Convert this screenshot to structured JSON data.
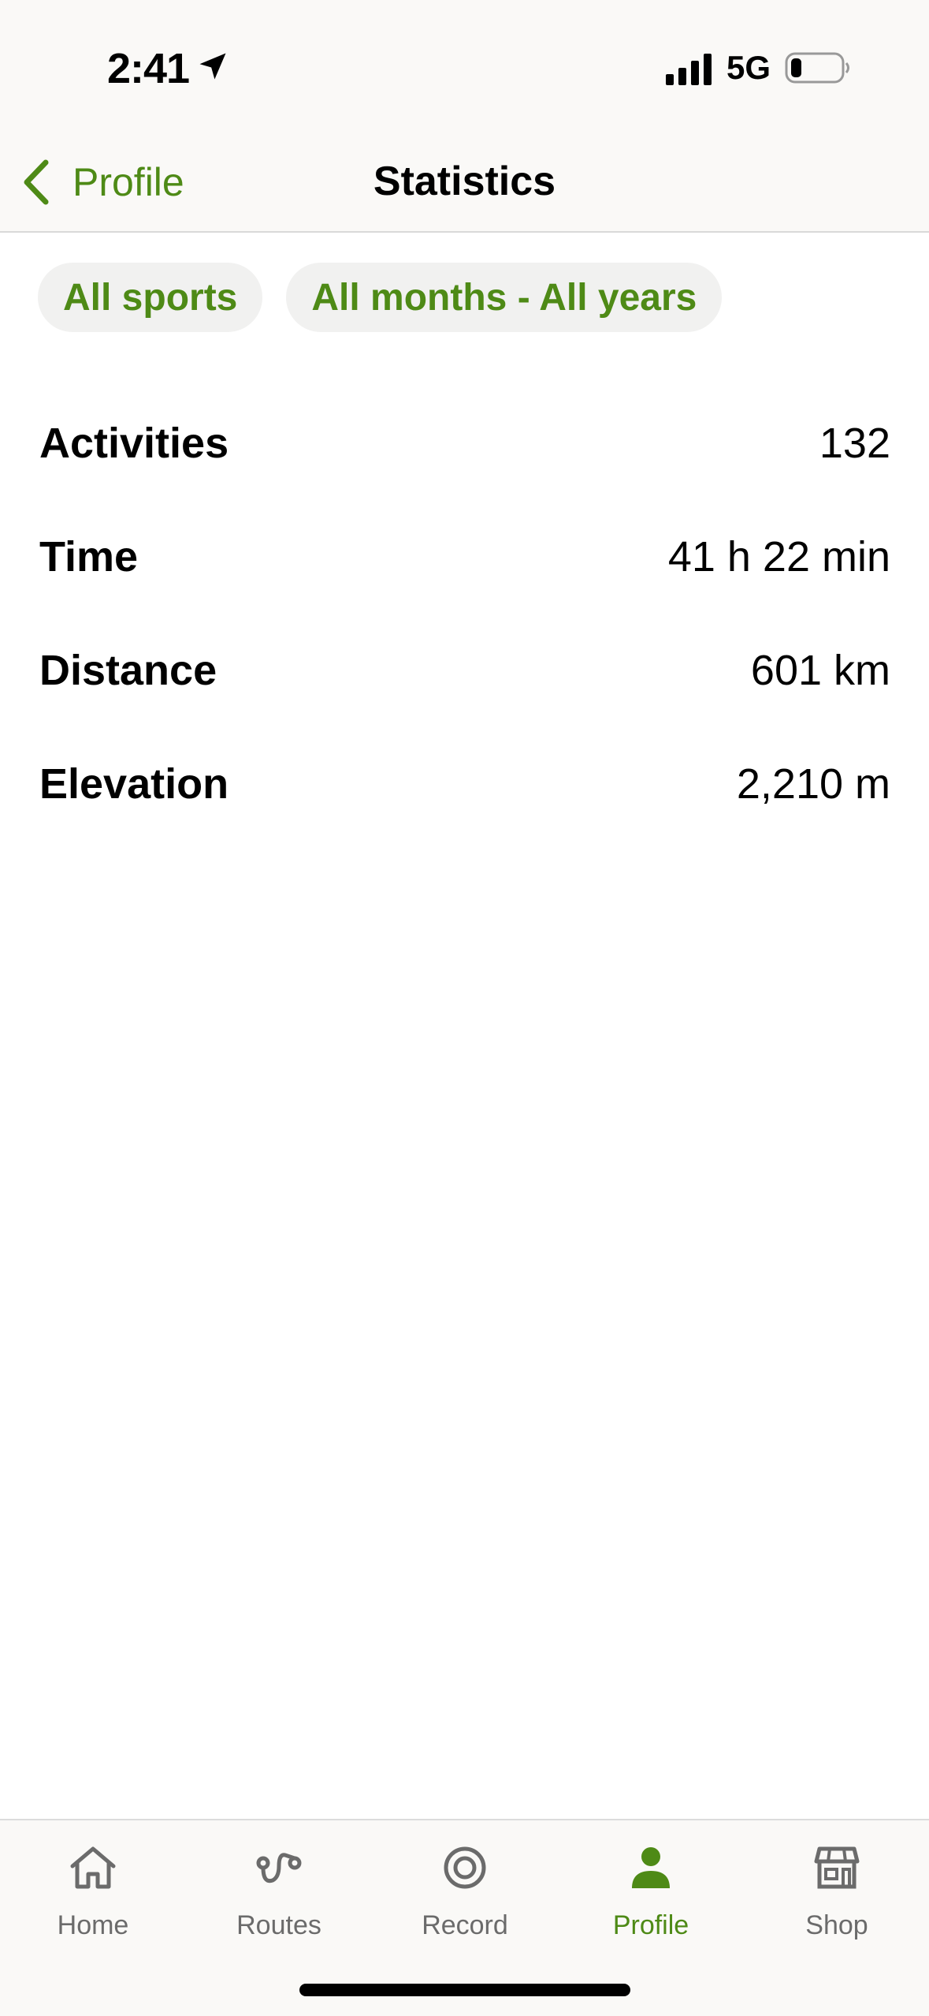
{
  "status_bar": {
    "time": "2:41",
    "network": "5G",
    "icons": [
      "location-arrow-icon",
      "signal-icon",
      "battery-icon"
    ]
  },
  "nav": {
    "back_label": "Profile",
    "title": "Statistics"
  },
  "filters": [
    {
      "label": "All sports"
    },
    {
      "label": "All months - All years"
    }
  ],
  "stats": [
    {
      "label": "Activities",
      "value": "132"
    },
    {
      "label": "Time",
      "value": "41 h 22 min"
    },
    {
      "label": "Distance",
      "value": "601 km"
    },
    {
      "label": "Elevation",
      "value": "2,210 m"
    }
  ],
  "tabs": [
    {
      "label": "Home",
      "icon": "home-icon"
    },
    {
      "label": "Routes",
      "icon": "routes-icon"
    },
    {
      "label": "Record",
      "icon": "record-icon"
    },
    {
      "label": "Profile",
      "icon": "profile-icon",
      "active": true
    },
    {
      "label": "Shop",
      "icon": "shop-icon"
    }
  ],
  "colors": {
    "accent": "#4e8a16",
    "chip_bg": "#f1f1f0",
    "bar_bg": "#faf9f7",
    "inactive_tab": "#6b6b6b"
  }
}
